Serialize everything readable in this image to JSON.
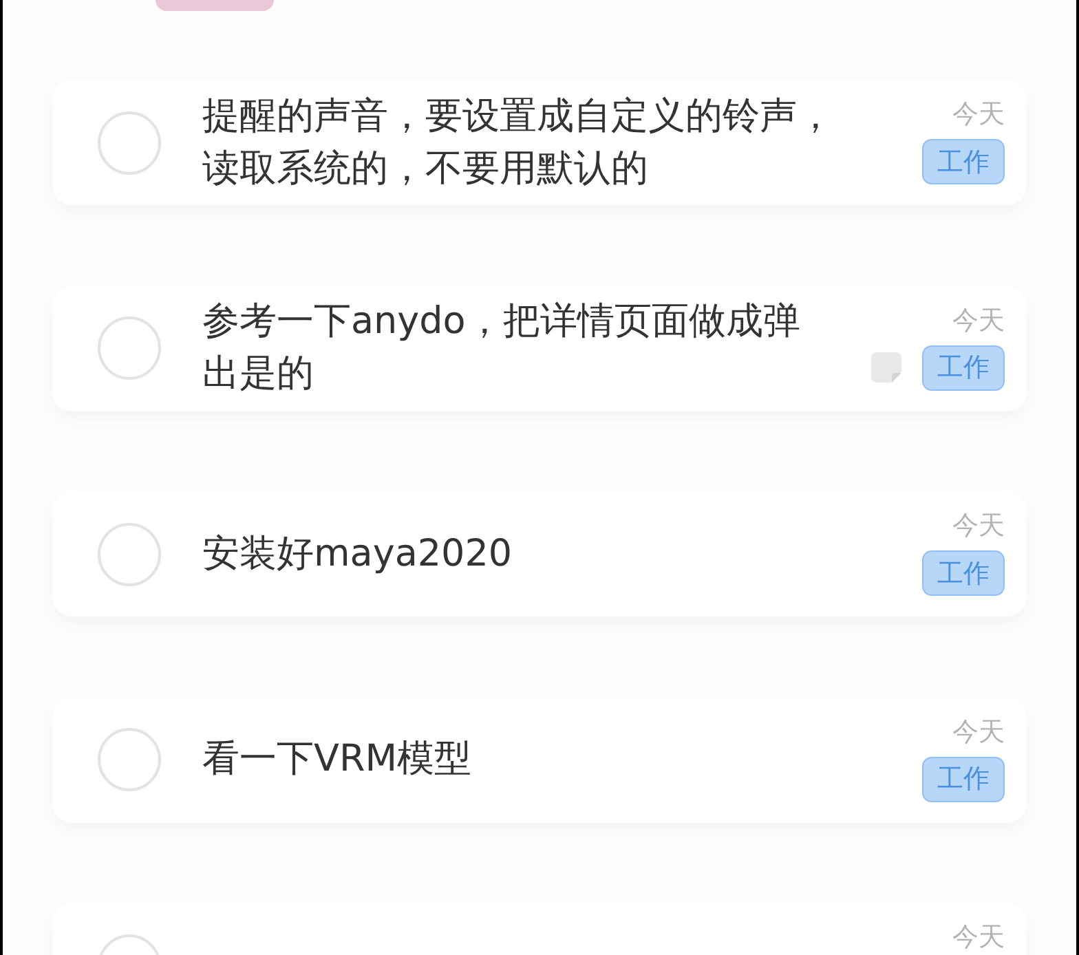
{
  "tasks": [
    {
      "title": "提醒的声音，要设置成自定义的铃声，读取系统的，不要用默认的",
      "checked": false,
      "date": "今天",
      "note": false,
      "tag": "工作"
    },
    {
      "title": "参考一下anydo，把详情页面做成弹出是的",
      "checked": false,
      "date": "今天",
      "note": true,
      "tag": "工作"
    },
    {
      "title": "安装好maya2020",
      "checked": false,
      "date": "今天",
      "note": false,
      "tag": "工作"
    },
    {
      "title": "看一下VRM模型",
      "checked": false,
      "date": "今天",
      "note": false,
      "tag": "工作"
    },
    {
      "checked": false,
      "date": "今天"
    }
  ]
}
